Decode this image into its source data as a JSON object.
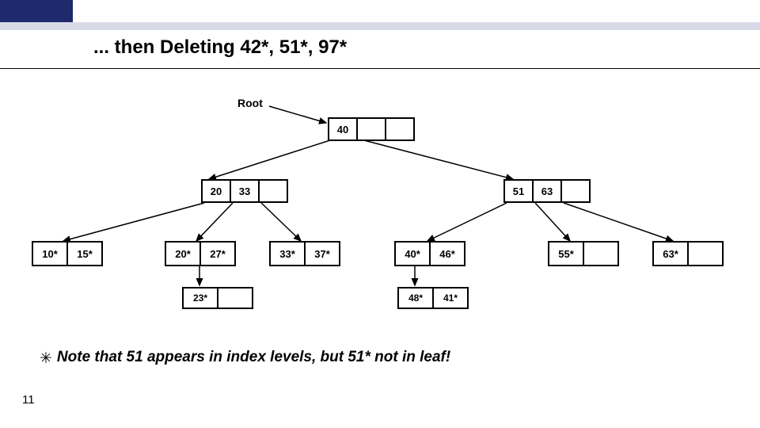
{
  "title": "... then Deleting 42*, 51*, 97*",
  "root_label": "Root",
  "page_number": "11",
  "note_text": "Note that 51 appears in index levels, but 51* not in leaf!",
  "root": {
    "k0": "40"
  },
  "left_idx": {
    "k0": "20",
    "k1": "33"
  },
  "right_idx": {
    "k0": "51",
    "k1": "63"
  },
  "leaves": {
    "l0": {
      "c0": "10*",
      "c1": "15*"
    },
    "l1": {
      "c0": "20*",
      "c1": "27*"
    },
    "l2": {
      "c0": "33*",
      "c1": "37*"
    },
    "l3": {
      "c0": "40*",
      "c1": "46*"
    },
    "l4": {
      "c0": "55*",
      "c1": ""
    },
    "l5": {
      "c0": "63*",
      "c1": ""
    }
  },
  "extra": {
    "e0": {
      "c0": "23*",
      "c1": ""
    },
    "e1": {
      "c0": "48*",
      "c1": "41*"
    }
  }
}
